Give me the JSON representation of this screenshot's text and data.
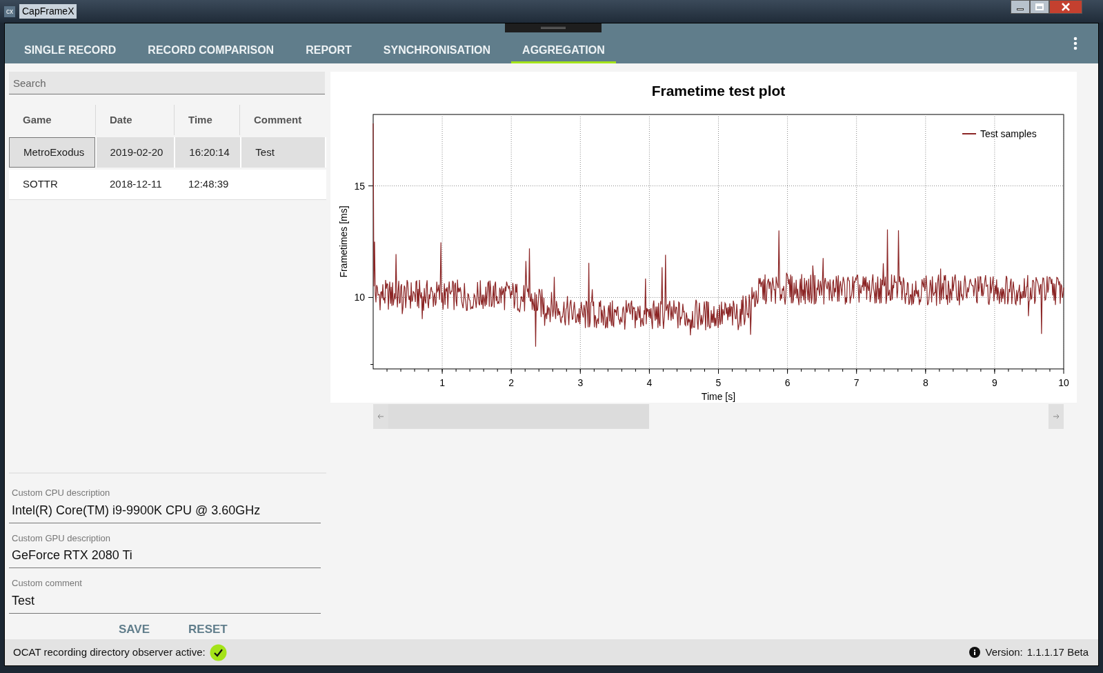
{
  "window": {
    "title": "CapFrameX",
    "icon_text": "cx"
  },
  "tabs": [
    {
      "label": "SINGLE RECORD",
      "selected": false
    },
    {
      "label": "RECORD COMPARISON",
      "selected": false
    },
    {
      "label": "REPORT",
      "selected": false
    },
    {
      "label": "SYNCHRONISATION",
      "selected": false
    },
    {
      "label": "AGGREGATION",
      "selected": true
    }
  ],
  "search": {
    "placeholder": "Search"
  },
  "table": {
    "columns": [
      "Game",
      "Date",
      "Time",
      "Comment"
    ],
    "rows": [
      {
        "cells": [
          "MetroExodus",
          "2019-02-20",
          "16:20:14",
          "Test"
        ],
        "selected": true
      },
      {
        "cells": [
          "SOTTR",
          "2018-12-11",
          "12:48:39"
        ],
        "selected": false
      }
    ]
  },
  "fields": [
    {
      "label": "Custom CPU description",
      "value": "Intel(R) Core(TM) i9-9900K CPU @ 3.60GHz"
    },
    {
      "label": "Custom GPU description",
      "value": "GeForce RTX 2080 Ti"
    },
    {
      "label": "Custom comment",
      "value": "Test"
    }
  ],
  "buttons": [
    "SAVE",
    "RESET"
  ],
  "plot": {
    "title": "Frametime test plot",
    "xlabel": "Time [s]",
    "ylabel": "Frametimes [ms]",
    "x_tick_labels": [
      "1",
      "2",
      "3",
      "4",
      "5",
      "6",
      "7",
      "8",
      "9",
      "10"
    ],
    "y_tick_labels": [
      "15",
      "10"
    ],
    "legend": "Test samples"
  },
  "status_bar": {
    "observer_text": "OCAT recording directory observer active:",
    "observer_active": true,
    "version_label": "Version:",
    "version": "1.1.1.17 Beta"
  }
}
